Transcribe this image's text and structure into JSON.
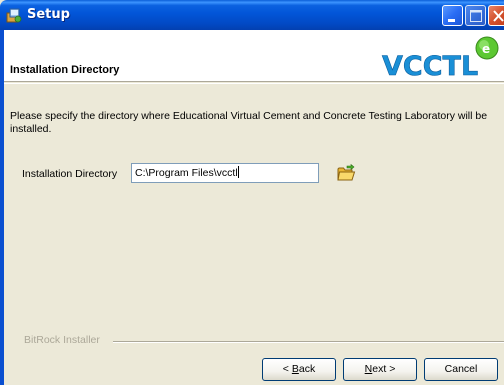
{
  "window": {
    "title": "Setup"
  },
  "header": {
    "page_title": "Installation Directory",
    "logo_text": "VCCTL"
  },
  "body": {
    "description": "Please specify the directory where Educational Virtual Cement and Concrete Testing Laboratory will be installed.",
    "directory_label": "Installation Directory",
    "directory_value": "C:\\Program Files\\vcctl"
  },
  "footer": {
    "installer_label": "BitRock Installer",
    "back_label_pre": "< ",
    "back_label_key": "B",
    "back_label_post": "ack",
    "next_label_key": "N",
    "next_label_post": "ext >",
    "cancel_label": "Cancel"
  },
  "colors": {
    "titlebar": "#0255d8",
    "dialog_bg": "#ece9d8",
    "logo_blue": "#1a8fd6",
    "logo_green": "#5cc832"
  }
}
